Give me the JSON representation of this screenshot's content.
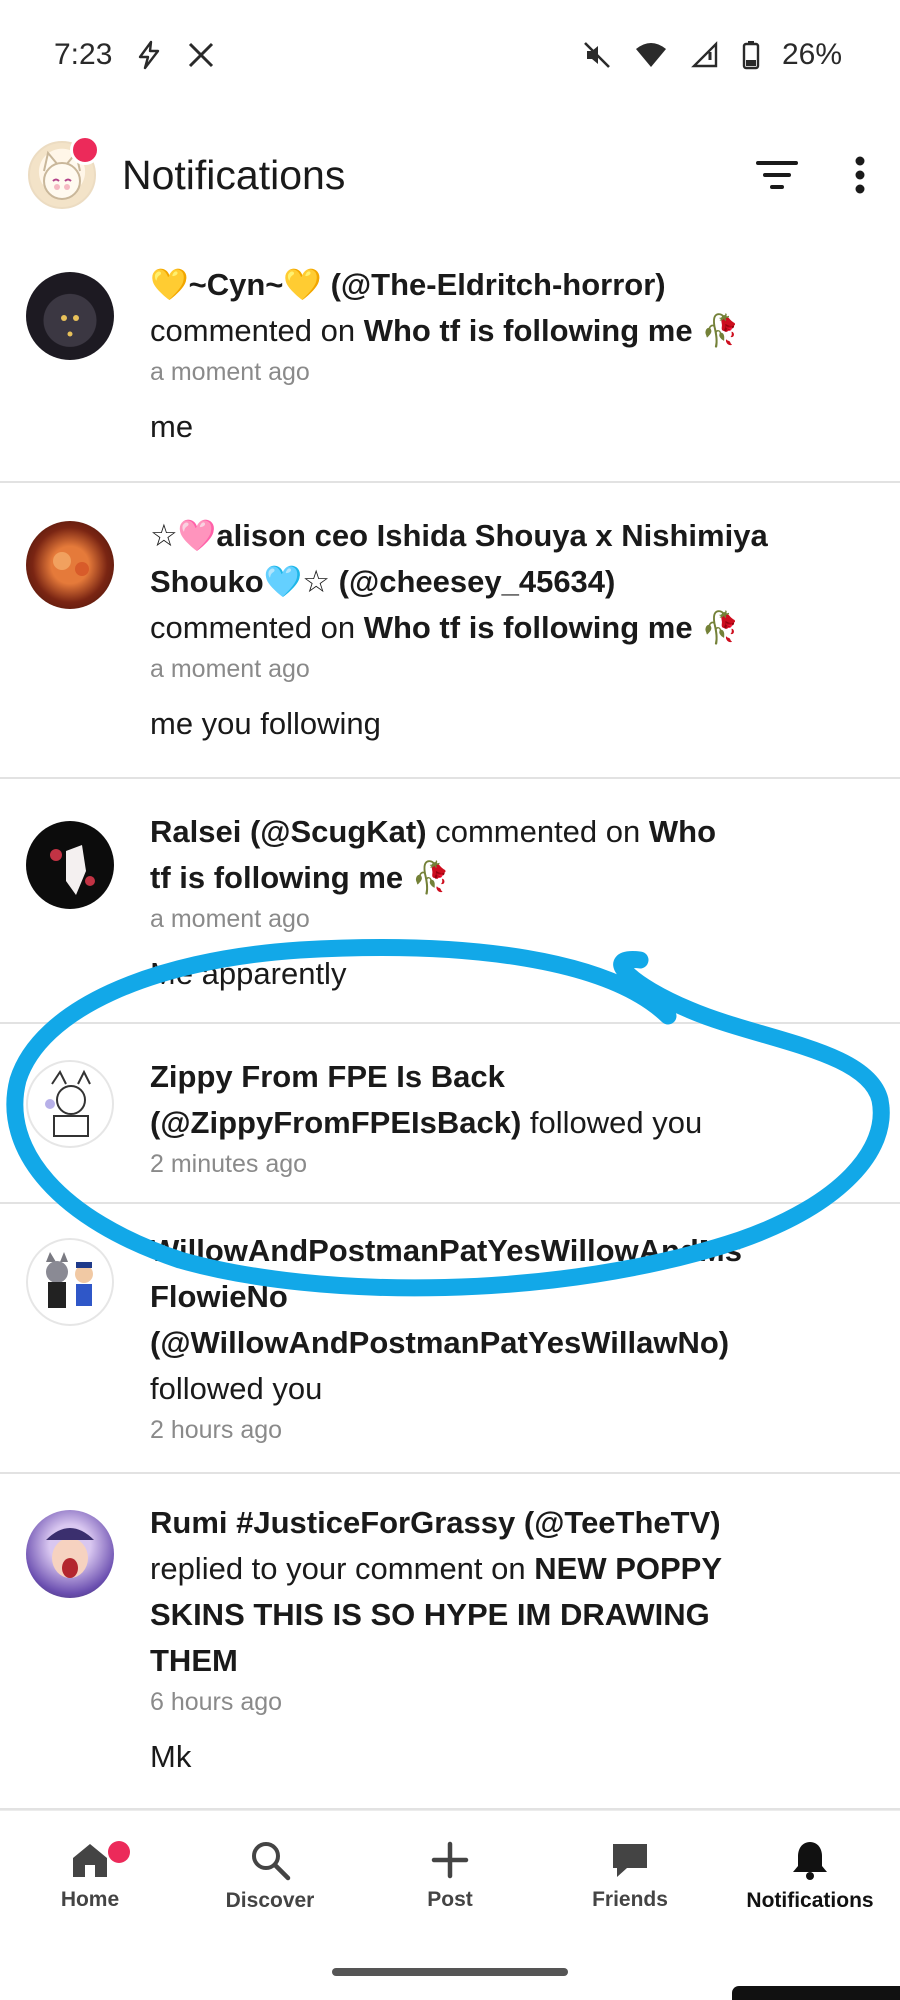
{
  "status_bar": {
    "time": "7:23",
    "battery": "26%"
  },
  "header": {
    "title": "Notifications"
  },
  "notifications": [
    {
      "user": "💛~Cyn~💛 (@The-Eldritch-horror)",
      "action": "commented on",
      "target": "Who tf is following me 🥀",
      "time": "a moment ago",
      "body": "me"
    },
    {
      "user_line1": "☆🩷alison ceo Ishida Shouya x Nishimiya",
      "user_line2": "Shouko🩵☆ (@cheesey_45634)",
      "action": "commented on",
      "target": "Who tf is following me 🥀",
      "time": "a moment ago",
      "body": "me you following"
    },
    {
      "user": "Ralsei (@ScugKat)",
      "action": "commented on",
      "target_line1": "Who",
      "target_line2": "tf is following me 🥀",
      "time": "a moment ago",
      "body": "Me apparently"
    },
    {
      "user_line1": "Zippy From FPE Is Back",
      "user_line2": "(@ZippyFromFPEIsBack)",
      "action": "followed you",
      "time": "2 minutes ago"
    },
    {
      "user_line1": "WillowAndPostmanPatYesWillowAndMs",
      "user_line2": "FlowieNo",
      "user_line3": "(@WillowAndPostmanPatYesWillawNo)",
      "action": "followed you",
      "time": "2 hours ago"
    },
    {
      "user": "Rumi #JusticeForGrassy (@TeeTheTV)",
      "action": "replied to your comment on",
      "target_line1": "NEW POPPY",
      "target_line2": "SKINS THIS IS SO HYPE IM DRAWING",
      "target_line3": "THEM",
      "time": "6 hours ago",
      "body": "Mk"
    }
  ],
  "bottom_nav": [
    {
      "label": "Home",
      "icon": "home-icon",
      "badge": true
    },
    {
      "label": "Discover",
      "icon": "search-icon"
    },
    {
      "label": "Post",
      "icon": "plus-icon"
    },
    {
      "label": "Friends",
      "icon": "chat-bubble-icon"
    },
    {
      "label": "Notifications",
      "icon": "bell-icon",
      "active": true
    }
  ],
  "colors": {
    "badge": "#ec2a5a",
    "highlight_ring": "#12a8e8",
    "divider": "#e2e2e2",
    "meta_text": "#8a8a8a"
  }
}
